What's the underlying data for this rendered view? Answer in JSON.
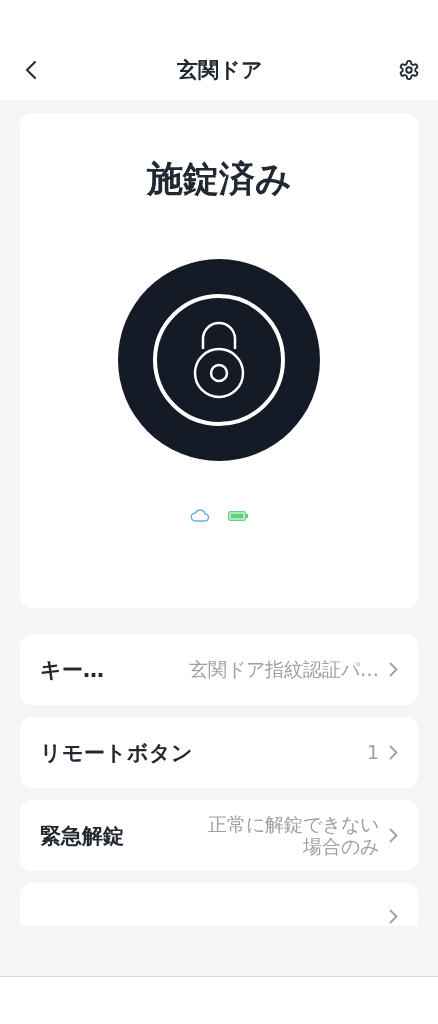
{
  "header": {
    "title": "玄関ドア"
  },
  "status": {
    "label": "施錠済み",
    "locked": true
  },
  "rows": [
    {
      "kind": "item",
      "label": "キー…",
      "value": "玄関ドア指紋認証パ…"
    },
    {
      "kind": "item",
      "label": "リモートボタン",
      "value": "1"
    },
    {
      "kind": "item",
      "label": "緊急解錠",
      "value": "正常に解錠できない場合のみ"
    },
    {
      "kind": "cut"
    }
  ]
}
